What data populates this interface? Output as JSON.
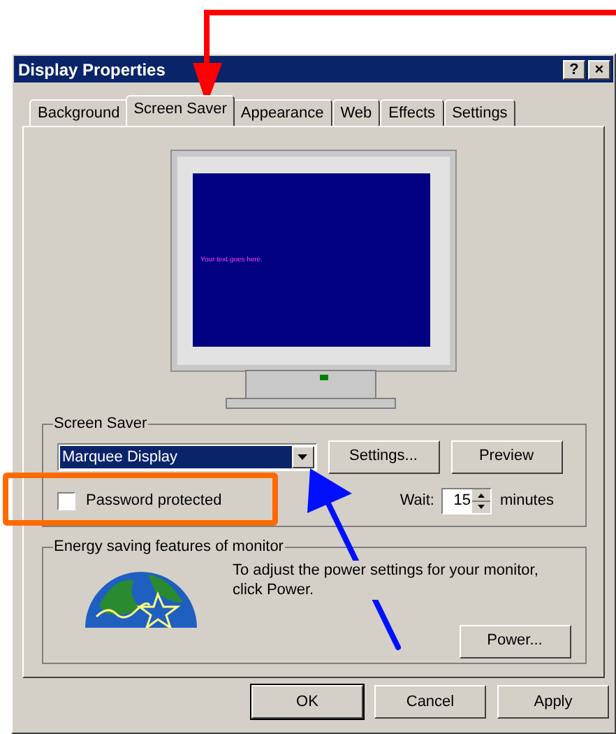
{
  "window": {
    "title": "Display Properties",
    "title_buttons": [
      "?",
      "×"
    ]
  },
  "tabs": [
    {
      "label": "Background",
      "selected": false
    },
    {
      "label": "Screen Saver",
      "selected": true
    },
    {
      "label": "Appearance",
      "selected": false
    },
    {
      "label": "Web",
      "selected": false
    },
    {
      "label": "Effects",
      "selected": false
    },
    {
      "label": "Settings",
      "selected": false
    }
  ],
  "preview": {
    "text": "Your text goes here."
  },
  "screen_saver": {
    "group_label": "Screen Saver",
    "selection": "Marquee Display",
    "settings_button": "Settings...",
    "preview_button": "Preview",
    "password": {
      "label": "Password protected",
      "checked": false
    },
    "wait_label": "Wait:",
    "wait_value": "15",
    "wait_unit": "minutes"
  },
  "energy": {
    "group_label": "Energy saving features of monitor",
    "text": "To adjust the power settings for your monitor, click Power.",
    "button": "Power..."
  },
  "buttons": [
    "OK",
    "Cancel",
    "Apply"
  ]
}
